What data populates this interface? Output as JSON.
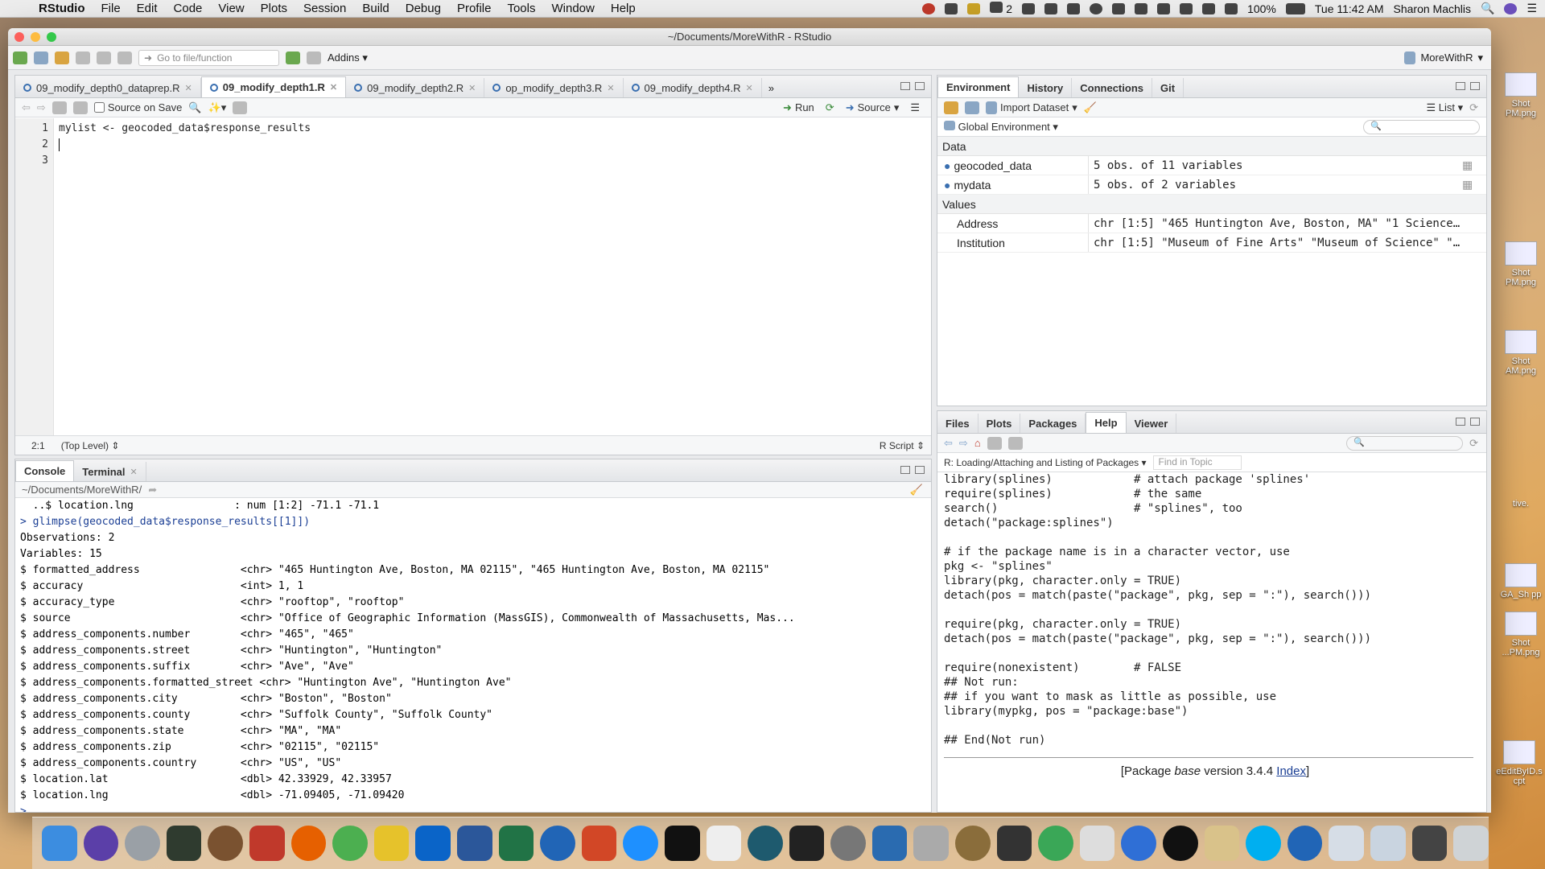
{
  "menubar": {
    "app": "RStudio",
    "items": [
      "File",
      "Edit",
      "Code",
      "View",
      "Plots",
      "Session",
      "Build",
      "Debug",
      "Profile",
      "Tools",
      "Window",
      "Help"
    ],
    "status": {
      "ai_count": "2",
      "battery": "100%",
      "clock": "Tue 11:42 AM",
      "user": "Sharon Machlis"
    }
  },
  "window": {
    "title": "~/Documents/MoreWithR - RStudio",
    "toolbar": {
      "goto_placeholder": "Go to file/function",
      "addins": "Addins",
      "project": "MoreWithR"
    }
  },
  "source": {
    "tabs": [
      {
        "label": "09_modify_depth0_dataprep.R"
      },
      {
        "label": "09_modify_depth1.R",
        "active": true
      },
      {
        "label": "09_modify_depth2.R"
      },
      {
        "label": "op_modify_depth3.R"
      },
      {
        "label": "09_modify_depth4.R"
      }
    ],
    "source_on_save": "Source on Save",
    "run": "Run",
    "source_btn": "Source",
    "lines": [
      "mylist <- geocoded_data$response_results",
      "",
      ""
    ],
    "line_numbers": [
      "1",
      "2",
      "3"
    ],
    "status": {
      "position": "2:1",
      "scope": "(Top Level)",
      "type": "R Script"
    }
  },
  "console": {
    "tabs": [
      "Console",
      "Terminal"
    ],
    "path": "~/Documents/MoreWithR/",
    "lines": [
      "  ..$ location.lng                : num [1:2] -71.1 -71.1",
      "> glimpse(geocoded_data$response_results[[1]])",
      "Observations: 2",
      "Variables: 15",
      "$ formatted_address                <chr> \"465 Huntington Ave, Boston, MA 02115\", \"465 Huntington Ave, Boston, MA 02115\"",
      "$ accuracy                         <int> 1, 1",
      "$ accuracy_type                    <chr> \"rooftop\", \"rooftop\"",
      "$ source                           <chr> \"Office of Geographic Information (MassGIS), Commonwealth of Massachusetts, Mas...",
      "$ address_components.number        <chr> \"465\", \"465\"",
      "$ address_components.street        <chr> \"Huntington\", \"Huntington\"",
      "$ address_components.suffix        <chr> \"Ave\", \"Ave\"",
      "$ address_components.formatted_street <chr> \"Huntington Ave\", \"Huntington Ave\"",
      "$ address_components.city          <chr> \"Boston\", \"Boston\"",
      "$ address_components.county        <chr> \"Suffolk County\", \"Suffolk County\"",
      "$ address_components.state         <chr> \"MA\", \"MA\"",
      "$ address_components.zip           <chr> \"02115\", \"02115\"",
      "$ address_components.country       <chr> \"US\", \"US\"",
      "$ location.lat                     <dbl> 42.33929, 42.33957",
      "$ location.lng                     <dbl> -71.09405, -71.09420",
      "> "
    ]
  },
  "environment": {
    "tabs": [
      "Environment",
      "History",
      "Connections",
      "Git"
    ],
    "import_dataset": "Import Dataset",
    "view_mode": "List",
    "scope": "Global Environment",
    "data_header": "Data",
    "data": [
      {
        "name": "geocoded_data",
        "value": "5 obs. of 11 variables"
      },
      {
        "name": "mydata",
        "value": "5 obs. of 2 variables"
      }
    ],
    "values_header": "Values",
    "values": [
      {
        "name": "Address",
        "value": "chr [1:5] \"465 Huntington Ave, Boston, MA\" \"1 Science…"
      },
      {
        "name": "Institution",
        "value": "chr [1:5] \"Museum of Fine Arts\" \"Museum of Science\" \"…"
      }
    ]
  },
  "help": {
    "tabs": [
      "Files",
      "Plots",
      "Packages",
      "Help",
      "Viewer"
    ],
    "topic": "R: Loading/Attaching and Listing of Packages",
    "find_placeholder": "Find in Topic",
    "lines": [
      "library(splines)            # attach package 'splines'",
      "require(splines)            # the same",
      "search()                    # \"splines\", too",
      "detach(\"package:splines\")",
      "",
      "# if the package name is in a character vector, use",
      "pkg <- \"splines\"",
      "library(pkg, character.only = TRUE)",
      "detach(pos = match(paste(\"package\", pkg, sep = \":\"), search()))",
      "",
      "require(pkg, character.only = TRUE)",
      "detach(pos = match(paste(\"package\", pkg, sep = \":\"), search()))",
      "",
      "require(nonexistent)        # FALSE",
      "## Not run:",
      "## if you want to mask as little as possible, use",
      "library(mypkg, pos = \"package:base\")",
      "",
      "## End(Not run)"
    ],
    "footer_pre": "[Package ",
    "footer_pkg": "base",
    "footer_mid": " version 3.4.4 ",
    "footer_link": "Index",
    "footer_post": "]"
  },
  "desktop_files": [
    "Shot PM.png",
    "Shot PM.png",
    "Shot AM.png",
    "tive.",
    "GA_Sh pp",
    "Shot ...PM.png",
    "eEditByID.s cpt"
  ]
}
